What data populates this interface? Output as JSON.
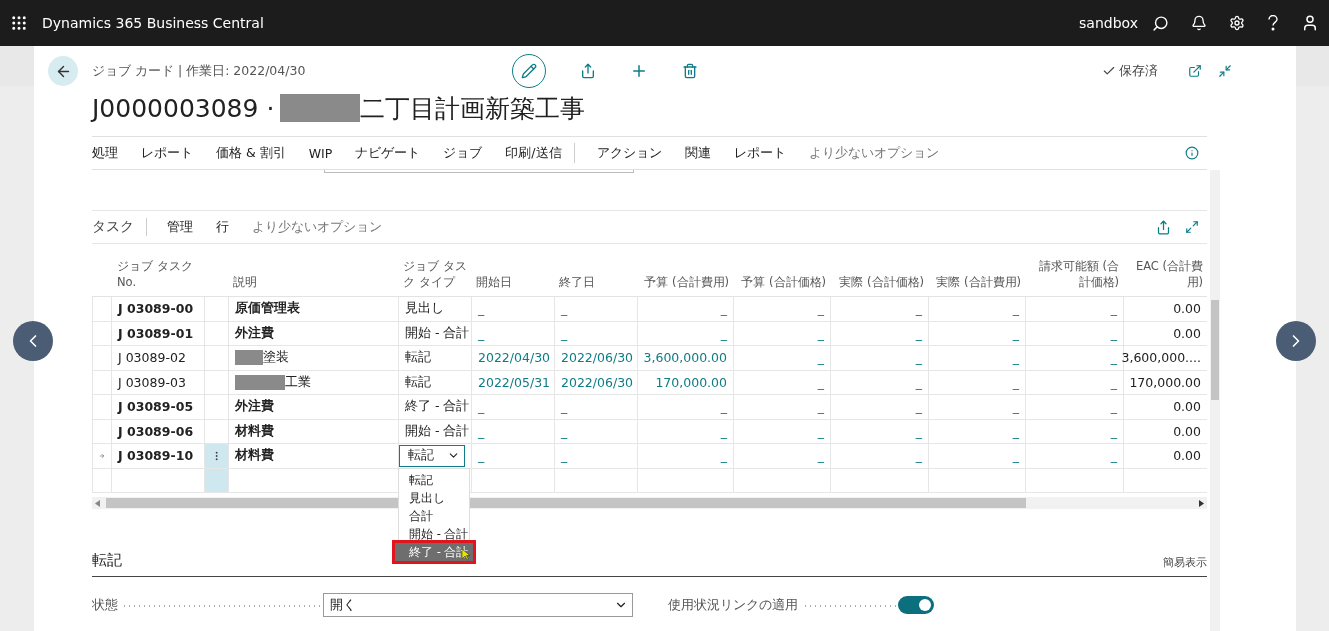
{
  "app_bar": {
    "title": "Dynamics 365 Business Central",
    "environment": "sandbox"
  },
  "page": {
    "breadcrumb": "ジョブ カード | 作業日: 2022/04/30",
    "title_number": "J0000003089 ·",
    "title_redacted": true,
    "title_name": "二丁目計画新築工事",
    "status": "保存済"
  },
  "action_menu": [
    {
      "label": "処理",
      "muted": false,
      "divider_after": false
    },
    {
      "label": "レポート",
      "muted": false,
      "divider_after": false
    },
    {
      "label": "価格 & 割引",
      "muted": false,
      "divider_after": false
    },
    {
      "label": "WIP",
      "muted": false,
      "divider_after": false
    },
    {
      "label": "ナビゲート",
      "muted": false,
      "divider_after": false
    },
    {
      "label": "ジョブ",
      "muted": false,
      "divider_after": false
    },
    {
      "label": "印刷/送信",
      "muted": false,
      "divider_after": true
    },
    {
      "label": "アクション",
      "muted": false,
      "divider_after": false
    },
    {
      "label": "関連",
      "muted": false,
      "divider_after": false
    },
    {
      "label": "レポート",
      "muted": false,
      "divider_after": false
    },
    {
      "label": "より少ないオプション",
      "muted": true,
      "divider_after": false
    }
  ],
  "tasks": {
    "title": "タスク",
    "actions": [
      {
        "label": "管理",
        "muted": false
      },
      {
        "label": "行",
        "muted": false
      },
      {
        "label": "より少ないオプション",
        "muted": true
      }
    ],
    "columns": [
      "ジョブ タスク No.",
      "説明",
      "ジョブ タスク タイプ",
      "開始日",
      "終了日",
      "予算 (合計費用)",
      "予算 (合計価格)",
      "実際 (合計価格)",
      "実際 (合計費用)",
      "請求可能額 (合計価格)",
      "EAC (合計費用)"
    ],
    "rows": [
      {
        "no": "J 03089-00",
        "description": "原価管理表",
        "redacted": false,
        "kind": "heading",
        "current": false,
        "type": "見出し",
        "start": "_",
        "end": "_",
        "budget_cost": "_",
        "budget_price": "_",
        "actual_price": "_",
        "actual_cost": "_",
        "invoiceable": "_",
        "eac": "0.00"
      },
      {
        "no": "J 03089-01",
        "description": "外注費",
        "redacted": false,
        "kind": "heading",
        "current": false,
        "type": "開始 - 合計",
        "start": "_",
        "end": "_",
        "budget_cost": "_",
        "budget_price": "_",
        "actual_price": "_",
        "actual_cost": "_",
        "invoiceable": "_",
        "eac": "0.00"
      },
      {
        "no": "J 03089-02",
        "description": "塗装",
        "redacted": true,
        "kind": "posting",
        "current": false,
        "type": "転記",
        "start": "2022/04/30",
        "end": "2022/06/30",
        "budget_cost": "3,600,000.00",
        "budget_price": "_",
        "actual_price": "_",
        "actual_cost": "_",
        "invoiceable": "_",
        "eac": "3,600,000...."
      },
      {
        "no": "J 03089-03",
        "description": "工業",
        "redacted": true,
        "kind": "posting",
        "current": false,
        "type": "転記",
        "start": "2022/05/31",
        "end": "2022/06/30",
        "budget_cost": "170,000.00",
        "budget_price": "_",
        "actual_price": "_",
        "actual_cost": "_",
        "invoiceable": "_",
        "eac": "170,000.00"
      },
      {
        "no": "J 03089-05",
        "description": "外注費",
        "redacted": false,
        "kind": "heading",
        "current": false,
        "type": "終了 - 合計",
        "start": "_",
        "end": "_",
        "budget_cost": "_",
        "budget_price": "_",
        "actual_price": "_",
        "actual_cost": "_",
        "invoiceable": "_",
        "eac": "0.00"
      },
      {
        "no": "J 03089-06",
        "description": "材料費",
        "redacted": false,
        "kind": "heading",
        "current": false,
        "type": "開始 - 合計",
        "start": "_",
        "end": "_",
        "budget_cost": "_",
        "budget_price": "_",
        "actual_price": "_",
        "actual_cost": "_",
        "invoiceable": "_",
        "eac": "0.00"
      },
      {
        "no": "J 03089-10",
        "description": "材料費",
        "redacted": false,
        "kind": "heading",
        "current": true,
        "type": "転記",
        "start": "_",
        "end": "_",
        "budget_cost": "_",
        "budget_price": "_",
        "actual_price": "_",
        "actual_cost": "_",
        "invoiceable": "_",
        "eac": "0.00"
      }
    ],
    "type_options": [
      {
        "label": "転記",
        "selected": false
      },
      {
        "label": "見出し",
        "selected": false
      },
      {
        "label": "合計",
        "selected": false
      },
      {
        "label": "開始 - 合計",
        "selected": false
      },
      {
        "label": "終了 - 合計",
        "selected": true
      }
    ]
  },
  "posting": {
    "title": "転記",
    "view_toggle": "簡易表示",
    "status_label": "状態",
    "status_value": "開く",
    "usage_link_label": "使用状況リンクの適用",
    "usage_link_on": true
  }
}
